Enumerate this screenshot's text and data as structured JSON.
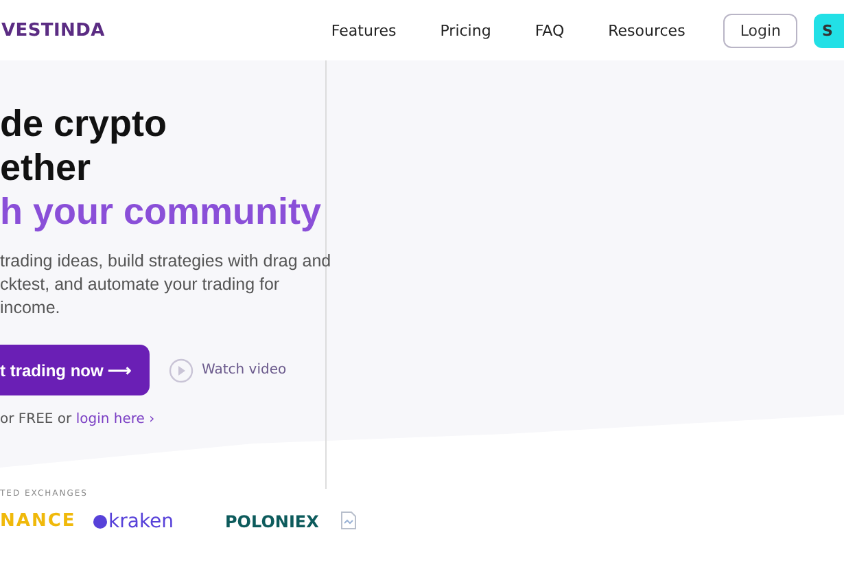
{
  "header": {
    "logo": "VESTINDA",
    "nav": [
      {
        "label": "Features"
      },
      {
        "label": "Pricing"
      },
      {
        "label": "FAQ"
      },
      {
        "label": "Resources"
      }
    ],
    "login": "Login",
    "signup": "S"
  },
  "hero": {
    "headline": [
      "de crypto",
      "ether"
    ],
    "headline_accent": "h your community",
    "description": [
      "trading ideas, build strategies with drag and",
      "cktest, and automate your trading for",
      "income."
    ],
    "cta": "t trading now ⟶",
    "watch": "Watch video",
    "signup_note": "or FREE or ",
    "login_link": "login here ›"
  },
  "exchanges": {
    "heading": "TED EXCHANGES",
    "logos": [
      {
        "kind": "binance",
        "label": "NANCE"
      },
      {
        "kind": "kraken",
        "label": "kraken"
      },
      {
        "kind": "poloniex",
        "label": "POLONIEX"
      },
      {
        "kind": "broken"
      }
    ]
  }
}
